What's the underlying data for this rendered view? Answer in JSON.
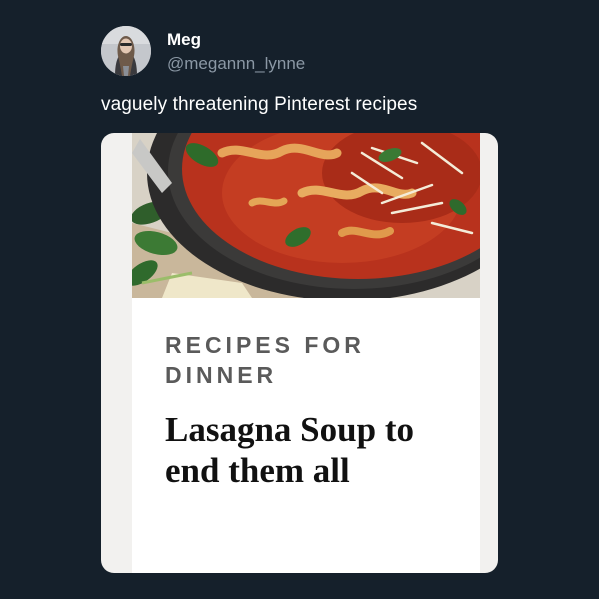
{
  "tweet": {
    "display_name": "Meg",
    "handle": "@megannn_lynne",
    "text": "vaguely threatening Pinterest recipes"
  },
  "card": {
    "kicker": "RECIPES FOR DINNER",
    "headline": "Lasagna Soup to end them all"
  },
  "colors": {
    "background": "#15202b",
    "name": "#ffffff",
    "handle": "#8b98a5",
    "card_text": "#111111",
    "kicker": "#5a5a5a"
  }
}
